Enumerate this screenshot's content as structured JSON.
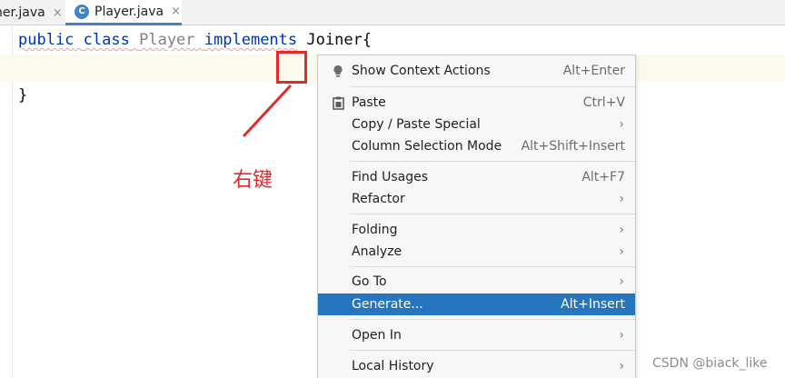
{
  "tabs": [
    {
      "label": "ner.java"
    },
    {
      "icon_letter": "C",
      "label": "Player.java",
      "active": true
    }
  ],
  "close_glyph": "×",
  "editor": {
    "line1": {
      "kw1": "public",
      "kw2": "class",
      "class_name": "Player",
      "kw3": "implements",
      "interface_name": "Joiner{"
    },
    "line3": "}"
  },
  "annotation": {
    "label": "右键",
    "color": "#e32a2a"
  },
  "context_menu": {
    "items": [
      {
        "label": "Show Context Actions",
        "shortcut": "Alt+Enter",
        "icon": "bulb-icon"
      },
      {
        "label": "Paste",
        "shortcut": "Ctrl+V",
        "icon": "clipboard-icon"
      },
      {
        "label": "Copy / Paste Special",
        "submenu": true
      },
      {
        "label": "Column Selection Mode",
        "shortcut": "Alt+Shift+Insert"
      },
      {
        "label": "Find Usages",
        "shortcut": "Alt+F7"
      },
      {
        "label": "Refactor",
        "submenu": true
      },
      {
        "label": "Folding",
        "submenu": true
      },
      {
        "label": "Analyze",
        "submenu": true
      },
      {
        "label": "Go To",
        "submenu": true
      },
      {
        "label": "Generate...",
        "shortcut": "Alt+Insert",
        "selected": true
      },
      {
        "label": "Open In",
        "submenu": true
      },
      {
        "label": "Local History",
        "submenu": true
      }
    ],
    "submenu_arrow": "›",
    "selection_color": "#2675bf"
  },
  "watermark": "CSDN @biack_like"
}
